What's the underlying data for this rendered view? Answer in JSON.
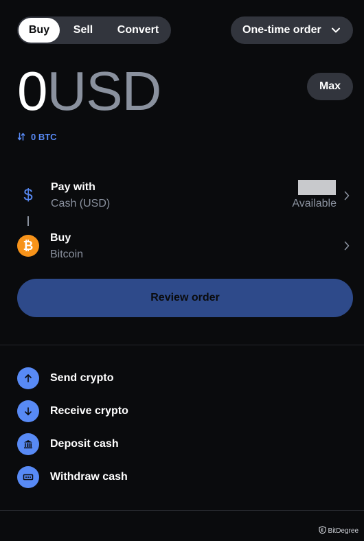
{
  "tabs": [
    {
      "label": "Buy",
      "active": true
    },
    {
      "label": "Sell",
      "active": false
    },
    {
      "label": "Convert",
      "active": false
    }
  ],
  "order_type": {
    "label": "One-time order",
    "icon": "chevron-down-icon"
  },
  "amount": {
    "value": "0",
    "currency": "USD"
  },
  "max_label": "Max",
  "crypto_conversion": {
    "value": "0 BTC",
    "icon": "swap-icon"
  },
  "pay_with": {
    "title": "Pay with",
    "subtitle": "Cash (USD)",
    "available_label": "Available",
    "icon": "dollar-sign-icon"
  },
  "buy_asset": {
    "title": "Buy",
    "subtitle": "Bitcoin",
    "icon": "bitcoin-icon",
    "icon_glyph": "₿"
  },
  "review_label": "Review order",
  "actions": [
    {
      "label": "Send crypto",
      "icon": "arrow-up-icon"
    },
    {
      "label": "Receive crypto",
      "icon": "arrow-down-icon"
    },
    {
      "label": "Deposit cash",
      "icon": "bank-icon"
    },
    {
      "label": "Withdraw cash",
      "icon": "cash-icon"
    }
  ],
  "watermark": "BitDegree",
  "colors": {
    "background": "#0a0b0d",
    "surface": "#32353d",
    "accent": "#588af5",
    "review_button": "#2e4a8a",
    "muted_text": "#8a919e",
    "bitcoin": "#f7931a"
  }
}
